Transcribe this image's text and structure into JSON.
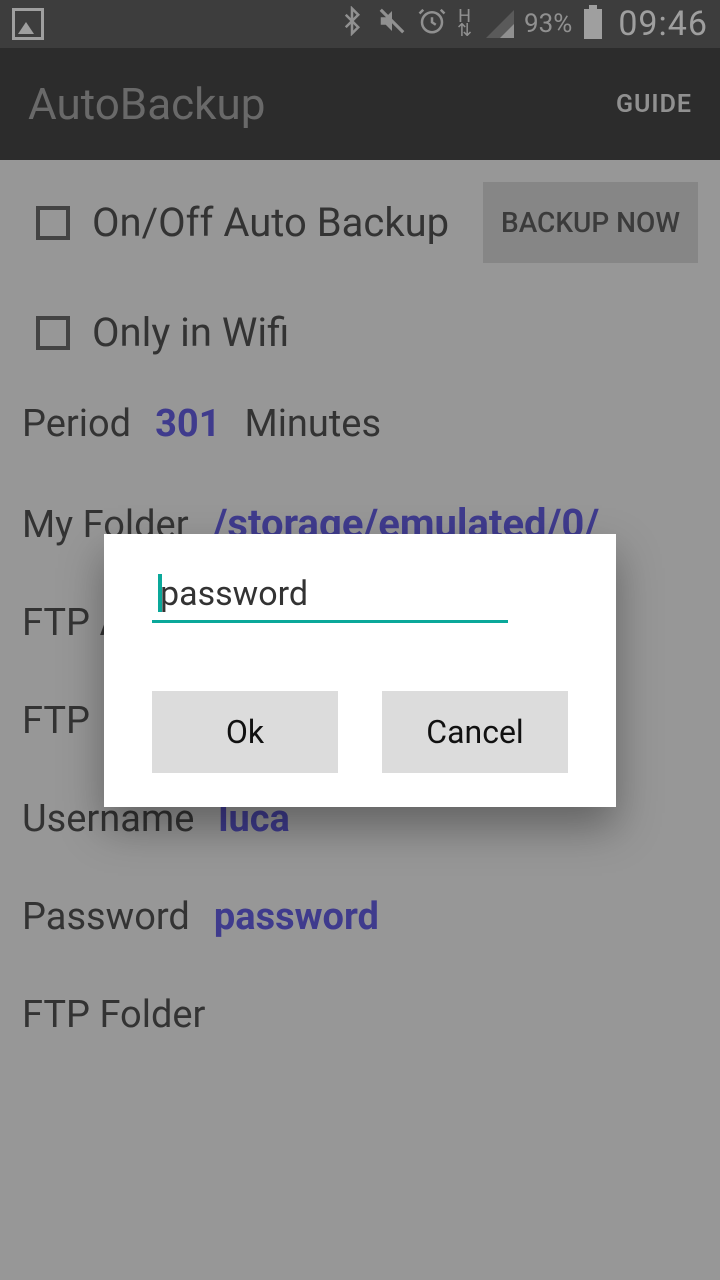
{
  "status": {
    "battery_pct": "93%",
    "time": "09:46"
  },
  "app": {
    "title": "AutoBackup",
    "guide": "GUIDE"
  },
  "main": {
    "auto_backup_label": "On/Off Auto Backup",
    "backup_now": "BACKUP NOW",
    "only_wifi": "Only in Wifi",
    "period_label": "Period",
    "period_value": "301",
    "period_unit": "Minutes",
    "my_folder_label": "My Folder",
    "my_folder_value": "/storage/emulated/0/",
    "ftp_a": "FTP A",
    "ftp": "FTP",
    "username_label": "Username",
    "username_value": "luca",
    "password_label": "Password",
    "password_value": "password",
    "ftp_folder_label": "FTP Folder"
  },
  "dialog": {
    "input_value": "password",
    "ok": "Ok",
    "cancel": "Cancel"
  }
}
